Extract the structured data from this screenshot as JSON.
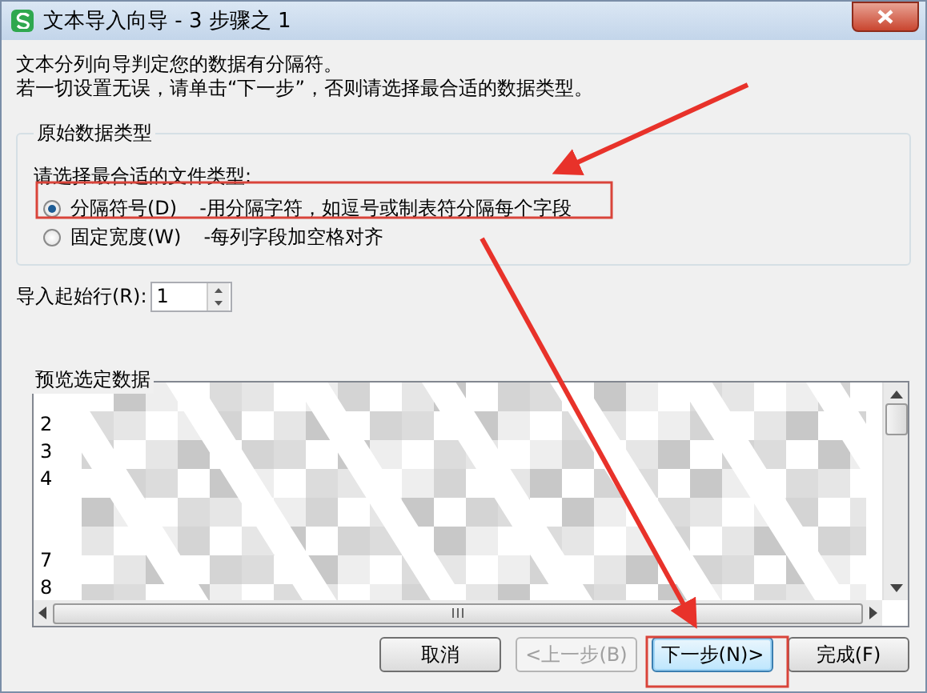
{
  "window": {
    "title": "文本导入向导 - 3 步骤之 1"
  },
  "description": [
    "文本分列向导判定您的数据有分隔符。",
    "若一切设置无误，请单击“下一步”，否则请选择最合适的数据类型。"
  ],
  "original_type": {
    "title": "原始数据类型",
    "prompt": "请选择最合适的文件类型:",
    "options": [
      {
        "label": "分隔符号(D)",
        "hint": "-用分隔字符，如逗号或制表符分隔每个字段",
        "selected": true
      },
      {
        "label": "固定宽度(W)",
        "hint": "-每列字段加空格对齐",
        "selected": false
      }
    ]
  },
  "start_row": {
    "label": "导入起始行(R):",
    "value": "1"
  },
  "preview": {
    "title": "预览选定数据",
    "rows": [
      {
        "kind": "covered"
      },
      {
        "kind": "numbered",
        "number": "2"
      },
      {
        "kind": "numbered",
        "number": "3"
      },
      {
        "kind": "numbered",
        "number": "4"
      },
      {
        "kind": "covered"
      },
      {
        "kind": "covered"
      },
      {
        "kind": "numbered",
        "number": "7"
      },
      {
        "kind": "numbered",
        "number": "8"
      }
    ]
  },
  "buttons": [
    {
      "label": "取消",
      "disabled": false,
      "focused": false
    },
    {
      "label": "<上一步(B)",
      "disabled": true,
      "focused": false
    },
    {
      "label": "下一步(N)>",
      "disabled": false,
      "focused": true
    },
    {
      "label": "完成(F)",
      "disabled": false,
      "focused": false
    }
  ]
}
